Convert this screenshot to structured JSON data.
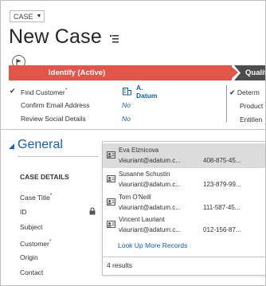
{
  "header": {
    "entity_selector": "CASE",
    "title": "New Case"
  },
  "process": {
    "active_stage": "Identify (Active)",
    "next_stage": "Qualify",
    "steps": [
      {
        "label": "Find Customer",
        "required": true,
        "checked": true,
        "value": "A. Datum"
      },
      {
        "label": "Confirm Email Address",
        "required": false,
        "checked": false,
        "value": "No"
      },
      {
        "label": "Review Social Details",
        "required": false,
        "checked": false,
        "value": "No"
      }
    ],
    "right_steps": [
      "Determ",
      "Product",
      "Entitlen"
    ]
  },
  "section": {
    "toggle": "◢",
    "title": "General",
    "subheading": "CASE DETAILS",
    "fields": [
      {
        "label": "Case Title",
        "required": true
      },
      {
        "label": "ID",
        "required": false
      },
      {
        "label": "Subject",
        "required": false
      },
      {
        "label": "Customer",
        "required": true
      },
      {
        "label": "Origin",
        "required": false
      },
      {
        "label": "Contact",
        "required": false
      }
    ]
  },
  "lookup": {
    "results": [
      {
        "name": "Eva Elznicova",
        "email": "vlauriant@adatum.c...",
        "phone": "408-875-45..."
      },
      {
        "name": "Susanne Schustin",
        "email": "vlauriant@adatum.c...",
        "phone": "123-879-99..."
      },
      {
        "name": "Tom O'Neill",
        "email": "vlauriant@adatum.c...",
        "phone": "111-587-45..."
      },
      {
        "name": "Vincent Lauriant",
        "email": "vlauriant@adatum.c...",
        "phone": "012-156-87..."
      }
    ],
    "more_link": "Look Up More Records",
    "count": "4 results"
  },
  "colors": {
    "accent": "#1160b7",
    "active_stage": "#e2564a",
    "inactive_stage": "#4d4d4d",
    "required": "#e0202a",
    "selected_row": "#dcdcdc"
  },
  "icons": {
    "caret": "caret-down-icon",
    "title_menu": "list-menu-icon",
    "flag": "flag-icon",
    "lookup": "lookup-account-icon",
    "lock": "lock-icon",
    "contact": "contact-card-icon"
  }
}
